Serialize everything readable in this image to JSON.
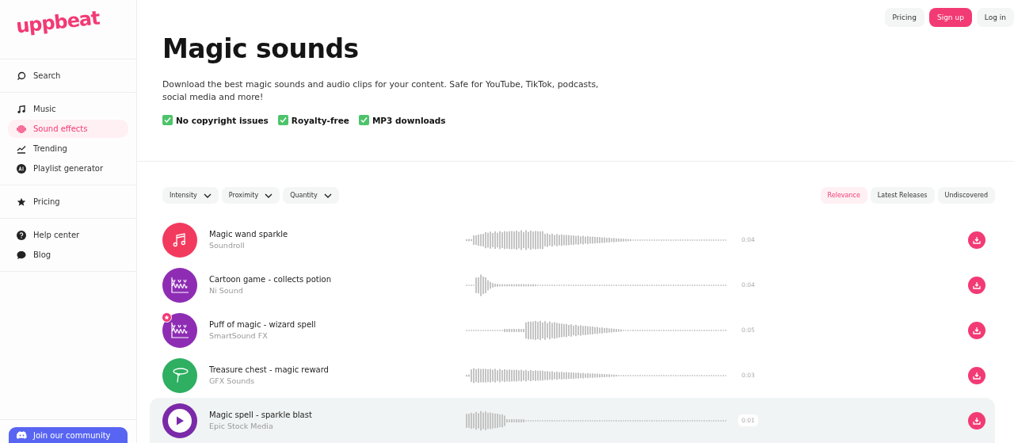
{
  "sidebar": {
    "logo": "uppbeat",
    "groups": [
      [
        {
          "label": "Search",
          "kind": "search",
          "selected": false
        }
      ],
      [
        {
          "label": "Music",
          "kind": "music",
          "selected": false
        },
        {
          "label": "Sound effects",
          "kind": "sfx",
          "selected": true
        },
        {
          "label": "Trending",
          "kind": "trend",
          "selected": false
        },
        {
          "label": "Playlist generator",
          "kind": "ai",
          "selected": false
        }
      ],
      [
        {
          "label": "Pricing",
          "kind": "star",
          "selected": false
        }
      ],
      [
        {
          "label": "Help center",
          "kind": "help",
          "selected": false
        },
        {
          "label": "Blog",
          "kind": "blog",
          "selected": false
        }
      ]
    ],
    "community_button": "Join our community"
  },
  "header_buttons": [
    {
      "label": "Pricing",
      "kind": "plain"
    },
    {
      "label": "Sign up",
      "kind": "primary"
    },
    {
      "label": "Log in",
      "kind": "plain"
    }
  ],
  "title": "Magic sounds",
  "description": "Download the best magic sounds and audio clips for your content. Safe for YouTube, TikTok, podcasts, social media and more!",
  "features": [
    {
      "label": "No copyright issues",
      "checked": true
    },
    {
      "label": "Royalty-free",
      "checked": true
    },
    {
      "label": "MP3 downloads",
      "checked": true
    }
  ],
  "filters": [
    "Intensity",
    "Proximity",
    "Quantity"
  ],
  "sort_tabs": [
    {
      "label": "Relevance",
      "selected": true
    },
    {
      "label": "Latest Releases",
      "selected": false
    },
    {
      "label": "Undiscovered",
      "selected": false
    }
  ],
  "tracks": [
    {
      "title": "Magic wand sparkle",
      "artist": "Soundroll",
      "duration": "0:04",
      "kind": "music",
      "color": "#f23a5e",
      "featured": false,
      "highlighted": false
    },
    {
      "title": "Cartoon game - collects potion",
      "artist": "Ni Sound",
      "duration": "0:04",
      "kind": "wave",
      "color": "#8e2db4",
      "featured": false,
      "highlighted": false
    },
    {
      "title": "Puff of magic - wizard spell",
      "artist": "SmartSound FX",
      "duration": "0:05",
      "kind": "wave",
      "color": "#8e2db4",
      "featured": true,
      "highlighted": false
    },
    {
      "title": "Treasure chest - magic reward",
      "artist": "GFX Sounds",
      "duration": "0:03",
      "kind": "mic",
      "color": "#2eaf61",
      "featured": false,
      "highlighted": false
    },
    {
      "title": "Magic spell - sparkle blast",
      "artist": "Epic Stock Media",
      "duration": "0:01",
      "kind": "play",
      "color": "#7a2aa8",
      "featured": false,
      "highlighted": true
    }
  ]
}
